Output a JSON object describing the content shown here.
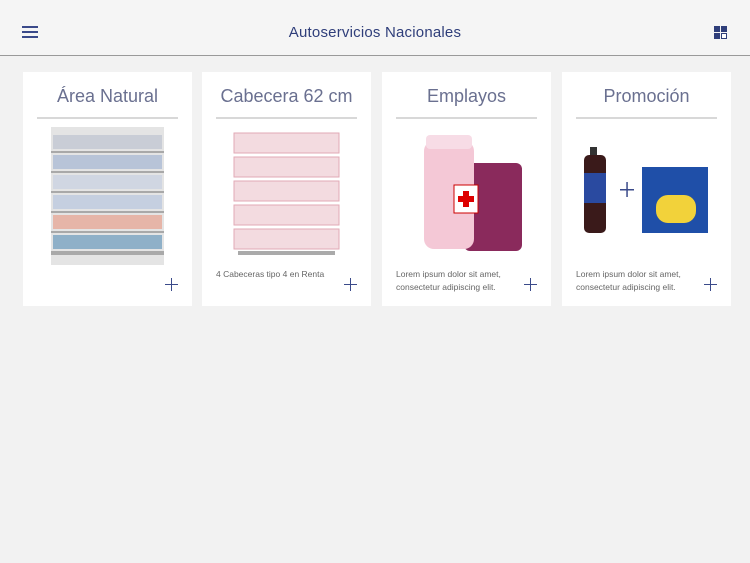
{
  "header": {
    "title": "Autoservicios Nacionales",
    "menu_icon": "hamburger-icon",
    "view_icon": "grid-view-icon"
  },
  "cards": [
    {
      "title": "Área Natural",
      "description": ""
    },
    {
      "title": "Cabecera 62 cm",
      "description": "4 Cabeceras tipo 4 en Renta"
    },
    {
      "title": "Emplayos",
      "description": "Lorem ipsum dolor sit amet, consectetur adipiscing elit."
    },
    {
      "title": "Promoción",
      "description": "Lorem ipsum dolor sit amet, consectetur adipiscing elit."
    }
  ],
  "colors": {
    "accent": "#2f3e7a",
    "background": "#f2f2f2"
  }
}
